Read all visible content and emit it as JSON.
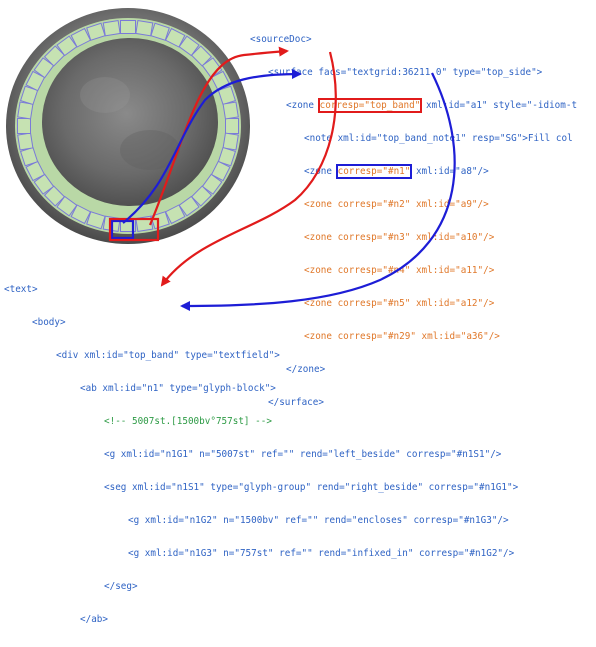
{
  "colors": {
    "tag": "#2f63c4",
    "attr": "#e0782a",
    "value": "#222222",
    "comment": "#2e9b46",
    "arrow_red": "#e11b1b",
    "arrow_blue": "#1d1dd6",
    "tablet_band": "#b9d8a6",
    "tablet_cell_border": "#7a7ad8",
    "tablet_interior": "#6a6a6a"
  },
  "top_code": {
    "l1": "<sourceDoc>",
    "l2": "<surface facs=\"textgrid:36211.0\" type=\"top_side\">",
    "l3a": "<zone ",
    "l3b": "corresp=\"top_band\"",
    "l3c": " xml:id=\"a1\" style=\"-idiom-t",
    "l4": "<note xml:id=\"top_band_note1\" resp=\"SG\">Fill col",
    "l5a": "<zone ",
    "l5b": "corresp=\"#n1\"",
    "l5c": " xml:id=\"a8\"/>",
    "l6": "<zone corresp=\"#n2\" xml:id=\"a9\"/>",
    "l7": "<zone corresp=\"#n3\" xml:id=\"a10\"/>",
    "l8": "<zone corresp=\"#n4\" xml:id=\"a11\"/>",
    "l9": "<zone corresp=\"#n5\" xml:id=\"a12\"/>",
    "l10": "<zone corresp=\"#n29\" xml:id=\"a36\"/>",
    "l11": "</zone>",
    "l12": "</surface>"
  },
  "bottom_code": {
    "l1": "<text>",
    "l2": "<body>",
    "l3": "<div xml:id=\"top_band\" type=\"textfield\">",
    "l4": "<ab xml:id=\"n1\" type=\"glyph-block\">",
    "l5": "<!-- 5007st.[1500bv°757st] -->",
    "l6": "<g xml:id=\"n1G1\" n=\"5007st\" ref=\"\" rend=\"left_beside\" corresp=\"#n1S1\"/>",
    "l7": "<seg xml:id=\"n1S1\" type=\"glyph-group\" rend=\"right_beside\" corresp=\"#n1G1\">",
    "l8": "<g xml:id=\"n1G2\" n=\"1500bv\" ref=\"\" rend=\"encloses\" corresp=\"#n1G3\"/>",
    "l9": "<g xml:id=\"n1G3\" n=\"757st\" ref=\"\" rend=\"infixed_in\" corresp=\"#n1G2\"/>",
    "l10": "</seg>",
    "l11": "</ab>"
  }
}
